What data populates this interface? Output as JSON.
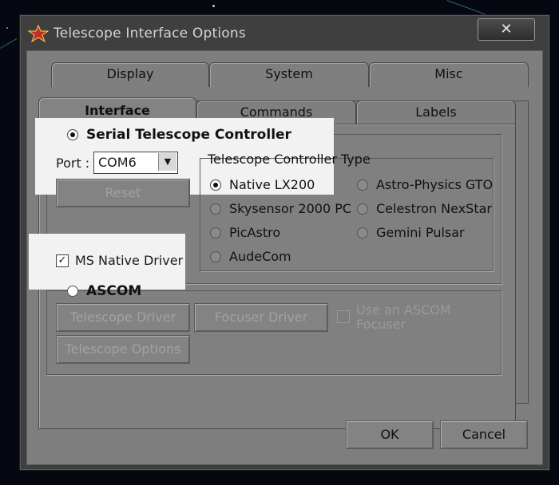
{
  "window": {
    "title": "Telescope Interface Options",
    "close_label": "✕"
  },
  "tabs": {
    "row_back": [
      {
        "label": "Display"
      },
      {
        "label": "System"
      },
      {
        "label": "Misc"
      }
    ],
    "row_front": [
      {
        "label": "Interface",
        "active": true
      },
      {
        "label": "Commands"
      },
      {
        "label": "Labels"
      }
    ]
  },
  "serial": {
    "title": "Serial Telescope Controller",
    "selected": true,
    "port_label": "Port :",
    "port_value": "COM6",
    "reset_label": "Reset",
    "ms_native_label": "MS Native Driver",
    "ms_native_checked": true
  },
  "controller_type": {
    "title": "Telescope Controller Type",
    "options": [
      {
        "label": "Native LX200",
        "selected": true
      },
      {
        "label": "Skysensor 2000 PC",
        "selected": false
      },
      {
        "label": "PicAstro",
        "selected": false
      },
      {
        "label": "AudeCom",
        "selected": false
      },
      {
        "label": "Astro-Physics GTO",
        "selected": false
      },
      {
        "label": "Celestron NexStar",
        "selected": false
      },
      {
        "label": "Gemini Pulsar",
        "selected": false
      }
    ]
  },
  "ascom": {
    "title": "ASCOM",
    "selected": false,
    "telescope_driver_label": "Telescope Driver",
    "focuser_driver_label": "Focuser Driver",
    "use_focuser_label_1": "Use an ASCOM",
    "use_focuser_label_2": "Focuser",
    "telescope_options_label": "Telescope Options"
  },
  "footer": {
    "ok_label": "OK",
    "cancel_label": "Cancel"
  },
  "colors": {
    "dialog_gray": "#808080",
    "highlight": "#f2f2f2"
  },
  "icons": [
    "app-star-icon",
    "close-icon",
    "dropdown-arrow-icon",
    "checkmark-icon"
  ]
}
